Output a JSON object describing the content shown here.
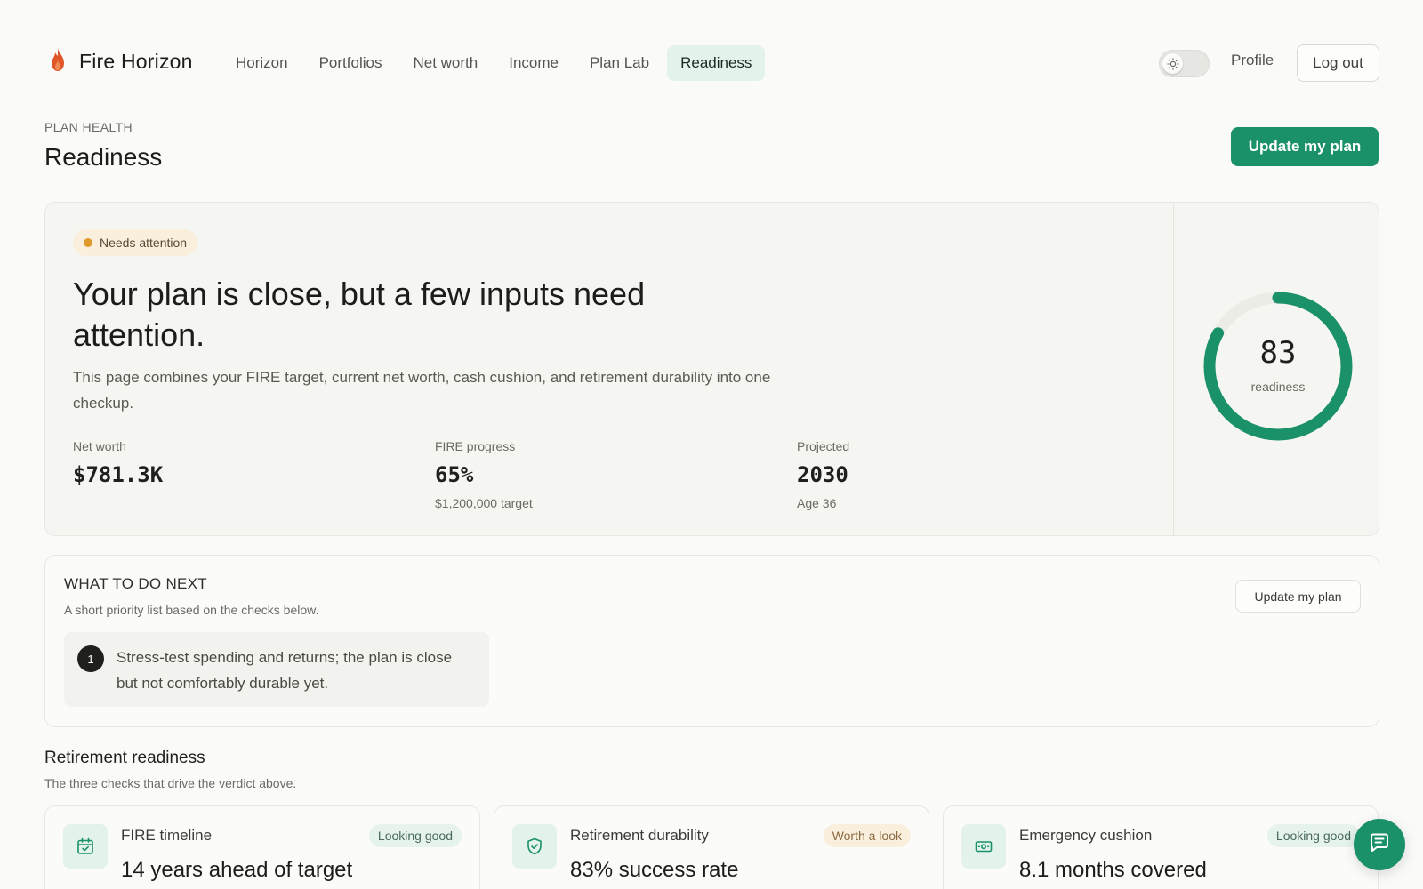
{
  "app": {
    "name": "Fire Horizon"
  },
  "nav": {
    "items": [
      {
        "label": "Horizon",
        "active": false
      },
      {
        "label": "Portfolios",
        "active": false
      },
      {
        "label": "Net worth",
        "active": false
      },
      {
        "label": "Income",
        "active": false
      },
      {
        "label": "Plan Lab",
        "active": false
      },
      {
        "label": "Readiness",
        "active": true
      }
    ],
    "theme_toggle": {
      "state": "light"
    },
    "profile_label": "Profile",
    "logout_label": "Log out"
  },
  "page": {
    "eyebrow": "PLAN HEALTH",
    "title": "Readiness",
    "primary_action": "Update my plan"
  },
  "hero": {
    "status_pill": "Needs attention",
    "headline": "Your plan is close, but a few inputs need attention.",
    "description": "This page combines your FIRE target, current net worth, cash cushion, and retirement durability into one checkup.",
    "stats": [
      {
        "label": "Net worth",
        "value": "$781.3K",
        "note": ""
      },
      {
        "label": "FIRE progress",
        "value": "65%",
        "note": "$1,200,000 target"
      },
      {
        "label": "Projected",
        "value": "2030",
        "note": "Age 36"
      }
    ],
    "gauge": {
      "value": "83",
      "label": "readiness",
      "fraction": 0.83
    }
  },
  "next_steps": {
    "title": "WHAT TO DO NEXT",
    "subtitle": "A short priority list based on the checks below.",
    "action_label": "Update my plan",
    "items": [
      {
        "number": "1",
        "text": "Stress-test spending and returns; the plan is close but not comfortably durable yet."
      }
    ]
  },
  "readiness": {
    "title": "Retirement readiness",
    "subtitle": "The three checks that drive the verdict above.",
    "checks": [
      {
        "icon": "calendar-icon",
        "title": "FIRE timeline",
        "value": "14 years ahead of target",
        "status": "Looking good"
      },
      {
        "icon": "shield-icon",
        "title": "Retirement durability",
        "value": "83% success rate",
        "status": "Worth a look"
      },
      {
        "icon": "cash-icon",
        "title": "Emergency cushion",
        "value": "8.1 months covered",
        "status": "Looking good"
      }
    ]
  },
  "colors": {
    "accent": "#1a9168",
    "accent_soft": "#e3f3ec",
    "warning": "#e09a2b",
    "warning_soft": "#faeedd",
    "flame": "#e0562b"
  }
}
